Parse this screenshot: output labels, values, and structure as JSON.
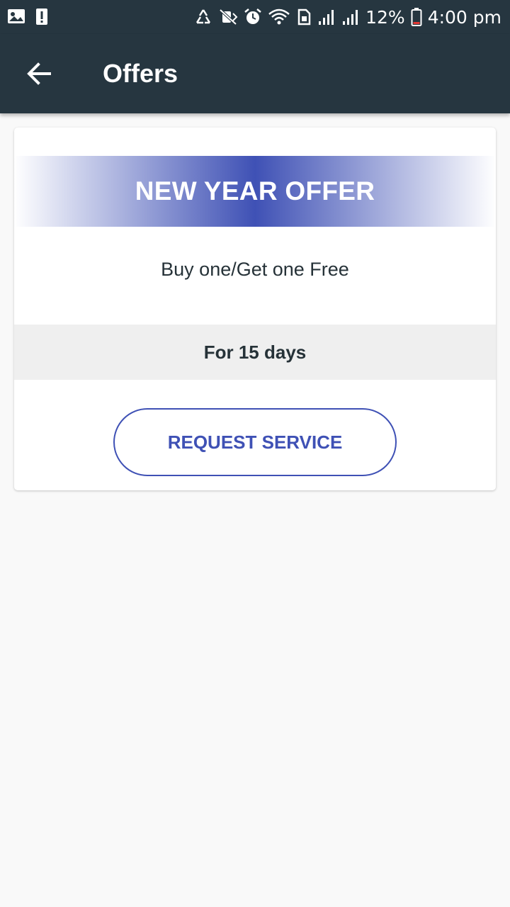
{
  "status_bar": {
    "battery_percent": "12%",
    "time": "4:00 pm",
    "icons_left": [
      "image-icon",
      "alert-icon"
    ],
    "icons_right": [
      "recycle-icon",
      "mute-icon",
      "alarm-icon",
      "wifi-icon",
      "sim-icon",
      "signal-icon",
      "signal-icon",
      "battery-icon"
    ]
  },
  "app_bar": {
    "title": "Offers",
    "back_icon": "arrow-back-icon",
    "background": "#263640"
  },
  "offer": {
    "title": "NEW YEAR OFFER",
    "description": "Buy one/Get one Free",
    "duration": "For 15 days",
    "button_label": "REQUEST SERVICE",
    "accent": "#3f51b5"
  }
}
